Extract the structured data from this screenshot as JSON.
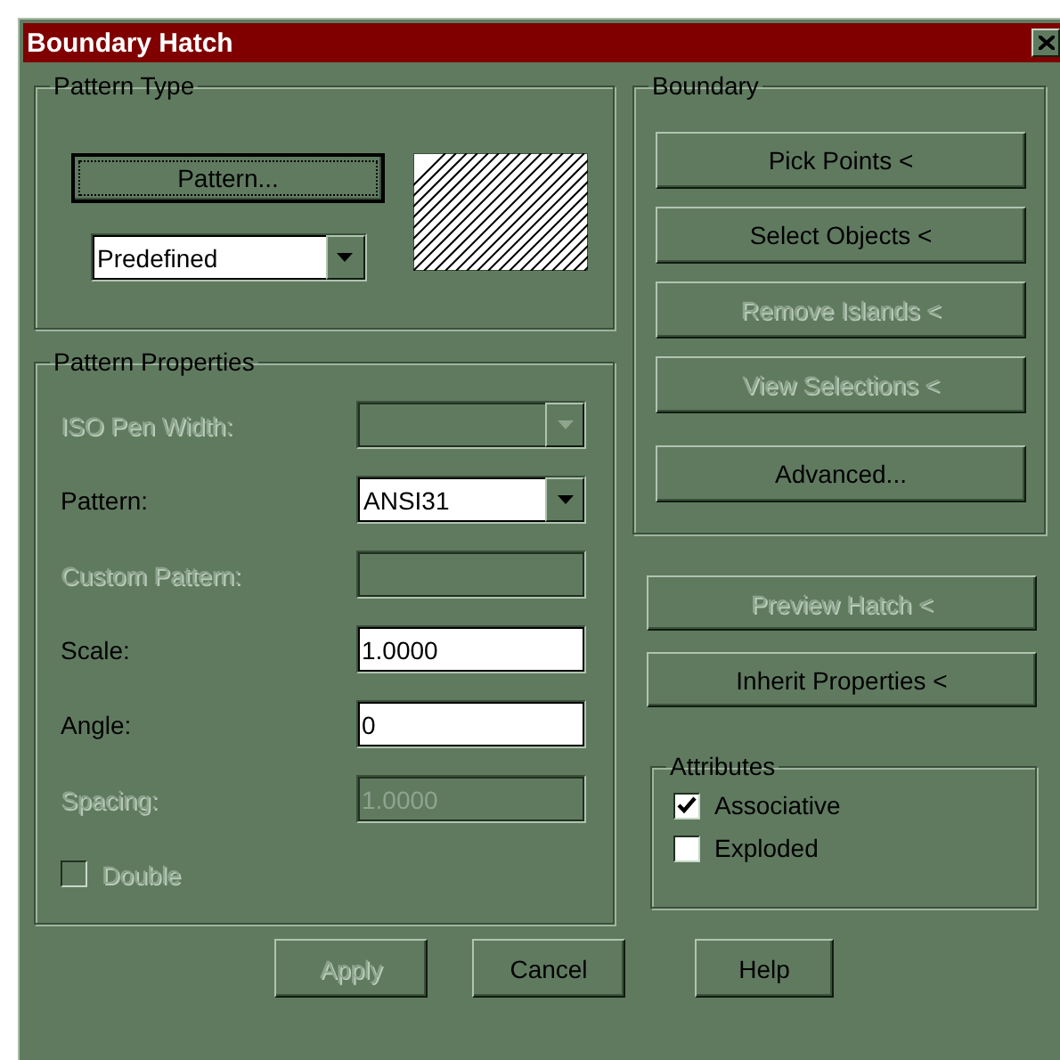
{
  "window": {
    "title": "Boundary Hatch"
  },
  "pattern_type": {
    "title": "Pattern Type",
    "button": {
      "label": "Pattern...",
      "focused": true
    },
    "dropdown": {
      "value": "Predefined"
    }
  },
  "pattern_properties": {
    "title": "Pattern Properties",
    "rows": [
      {
        "kind": "dropdown",
        "label": "ISO Pen Width:",
        "disabled": true
      },
      {
        "kind": "dropdown",
        "label": "Pattern:",
        "value": "ANSI31",
        "disabled": false
      },
      {
        "kind": "field",
        "label": "Custom Pattern:",
        "disabled": true
      },
      {
        "kind": "field",
        "label": "Scale:",
        "value": "1.0000",
        "disabled": false
      },
      {
        "kind": "field",
        "label": "Angle:",
        "value": "0",
        "disabled": false
      },
      {
        "kind": "field",
        "label": "Spacing:",
        "value": "1.0000",
        "disabled": true
      },
      {
        "kind": "checkbox",
        "label": "Double",
        "checked": false,
        "disabled": true
      }
    ]
  },
  "boundary": {
    "title": "Boundary",
    "buttons": [
      {
        "label": "Pick Points <",
        "disabled": false
      },
      {
        "label": "Select Objects <",
        "disabled": false
      },
      {
        "label": "Remove Islands <",
        "disabled": true
      },
      {
        "label": "View Selections <",
        "disabled": true
      },
      {
        "label": "Advanced...",
        "disabled": false
      }
    ]
  },
  "actions": [
    {
      "label": "Preview Hatch <",
      "disabled": true
    },
    {
      "label": "Inherit Properties <",
      "disabled": false
    }
  ],
  "attributes": {
    "title": "Attributes",
    "options": [
      {
        "label": "Associative",
        "checked": true
      },
      {
        "label": "Exploded",
        "checked": false
      }
    ]
  },
  "footer_buttons": [
    {
      "label": "Apply",
      "disabled": true
    },
    {
      "label": "Cancel",
      "disabled": false
    },
    {
      "label": "Help",
      "disabled": false
    }
  ]
}
